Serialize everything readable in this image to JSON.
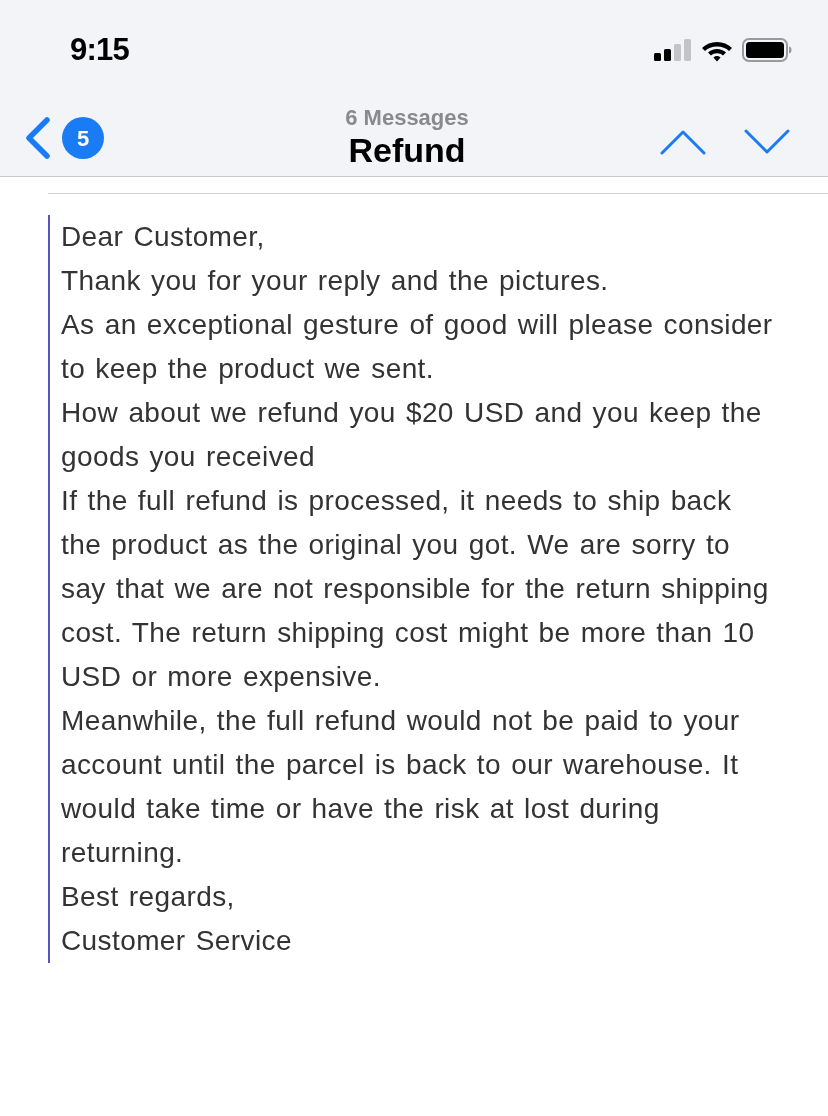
{
  "status_bar": {
    "time": "9:15"
  },
  "nav": {
    "back_count": "5",
    "subtitle": "6 Messages",
    "title": "Refund"
  },
  "message": {
    "paragraphs": [
      "Dear Customer,",
      "Thank you for your reply and the pictures.",
      "As an exceptional gesture of good will please consider to keep the product we sent.",
      "How about we refund you $20 USD and you keep the goods you received",
      "If the full refund is processed, it needs to ship back the product as the original you got. We are sorry to say that we are not responsible for the return shipping cost. The return shipping cost might be more than 10 USD or more expensive.",
      "Meanwhile, the full refund would not be paid to your account until the parcel is back to our warehouse. It would take time or have the risk at lost during returning.",
      "Best regards,",
      "Customer Service"
    ]
  }
}
